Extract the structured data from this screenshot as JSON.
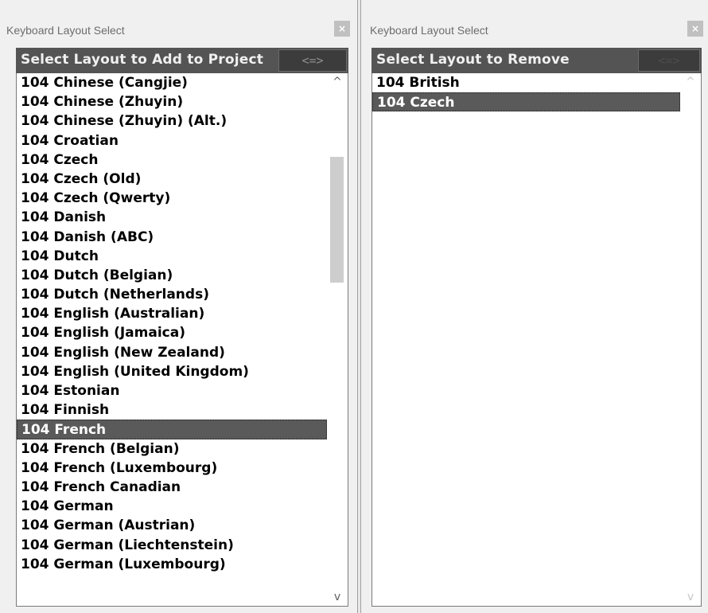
{
  "left_panel": {
    "title": "Keyboard Layout Select",
    "close_label": "×",
    "header": "Select Layout to Add to Project",
    "swap_label": "<=>",
    "items": [
      "104 Chinese (Cangjie)",
      "104 Chinese (Zhuyin)",
      "104 Chinese (Zhuyin) (Alt.)",
      "104 Croatian",
      "104 Czech",
      "104 Czech (Old)",
      "104 Czech (Qwerty)",
      "104 Danish",
      "104 Danish (ABC)",
      "104 Dutch",
      "104 Dutch (Belgian)",
      "104 Dutch (Netherlands)",
      "104 English (Australian)",
      "104 English (Jamaica)",
      "104 English (New Zealand)",
      "104 English (United Kingdom)",
      "104 Estonian",
      "104 Finnish",
      "104 French",
      "104 French (Belgian)",
      "104 French (Luxembourg)",
      "104 French Canadian",
      "104 German",
      "104 German (Austrian)",
      "104 German (Liechtenstein)",
      "104 German (Luxembourg)"
    ],
    "selected_index": 18,
    "scroll_up_icon": "^",
    "scroll_down_icon": "v"
  },
  "right_panel": {
    "title": "Keyboard Layout Select",
    "close_label": "×",
    "header": "Select Layout to Remove",
    "swap_label": "<=>",
    "items": [
      "104 British",
      "104 Czech"
    ],
    "selected_index": 1,
    "scroll_up_icon": "^",
    "scroll_down_icon": "v"
  }
}
